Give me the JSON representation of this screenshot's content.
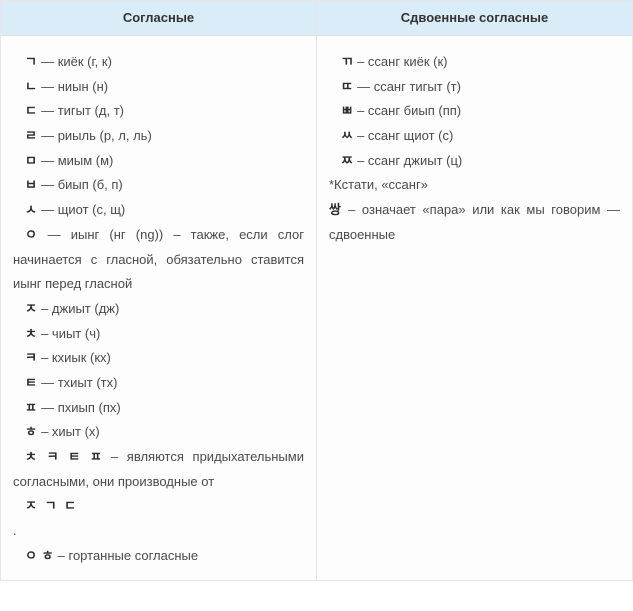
{
  "left": {
    "header": "Согласные",
    "r1_h": "ㄱ",
    "r1_t": " — киёк (г, к)",
    "r2_h": "ㄴ",
    "r2_t": " — ниын (н)",
    "r3_h": "ㄷ",
    "r3_t": " — тигыт (д, т)",
    "r4_h": "ㄹ",
    "r4_t": " — риыль (р, л, ль)",
    "r5_h": "ㅁ",
    "r5_t": " — миым (м)",
    "r6_h": "ㅂ",
    "r6_t": " — биып (б, п)",
    "r7_h": "ㅅ",
    "r7_t": " — щиот (с, щ)",
    "r8_h": "ㅇ",
    "r8_t": " — иынг (нг (ng)) – также, если слог начинается с гласной, обязательно ставится иынг перед гласной",
    "r9_h": "ㅈ",
    "r9_t": " – джиыт (дж)",
    "r10_h": "ㅊ",
    "r10_t": " – чиыт (ч)",
    "r11_h": "ㅋ",
    "r11_t": " – кхиык (кх)",
    "r12_h": "ㅌ",
    "r12_t": " — тхиыт (тх)",
    "r13_h": "ㅍ",
    "r13_t": " — пхиып (пх)",
    "r14_h": "ㅎ",
    "r14_t": " – хиыт (х)",
    "note1_h": "ㅊ ㅋ ㅌ ㅍ",
    "note1_t": " – являются придыхательными согласными, они производные от",
    "note2": "ㅈ ㄱ ㄷ",
    "dot": ".",
    "note3_h": "ㅇ ㅎ",
    "note3_t": " – гортанные согласные"
  },
  "right": {
    "header": "Сдвоенные согласные",
    "r1_h": "ㄲ",
    "r1_t": " – ссанг киёк (к)",
    "r2_h": "ㄸ",
    "r2_t": " — ссанг тигыт (т)",
    "r3_h": "ㅃ",
    "r3_t": " – ссанг биып (пп)",
    "r4_h": "ㅆ",
    "r4_t": " – ссанг щиот (с)",
    "r5_h": "ㅉ",
    "r5_t": " – ссанг джиыт (ц)",
    "star": "*Кстати, «ссанг»",
    "mean_h": "쌍",
    "mean_t": " – означает «пара» или как мы говорим — сдвоенные"
  }
}
